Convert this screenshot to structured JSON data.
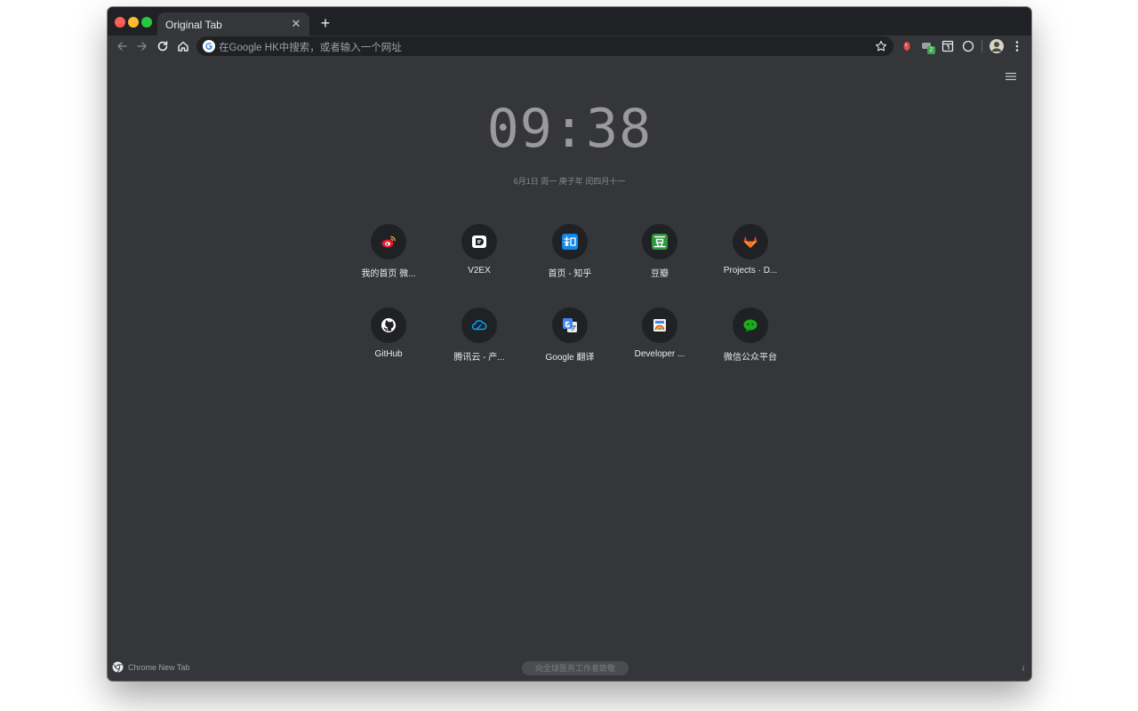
{
  "tab": {
    "title": "Original Tab",
    "close": "✕",
    "new": "+"
  },
  "omnibox": {
    "placeholder": "在Google HK中搜索，或者输入一个网址"
  },
  "extensions": {
    "badge": "2"
  },
  "clock": {
    "time": "09:38",
    "date": "6月1日 周一   庚子年 闰四月十一"
  },
  "shortcuts": [
    {
      "label": "我的首页 微...",
      "icon": "weibo-icon"
    },
    {
      "label": "V2EX",
      "icon": "v2ex-icon"
    },
    {
      "label": "首页 - 知乎",
      "icon": "zhihu-icon"
    },
    {
      "label": "豆瓣",
      "icon": "douban-icon"
    },
    {
      "label": "Projects · D...",
      "icon": "gitlab-icon"
    },
    {
      "label": "GitHub",
      "icon": "github-icon"
    },
    {
      "label": "腾讯云 - 产...",
      "icon": "tencent-cloud-icon"
    },
    {
      "label": "Google 翻译",
      "icon": "google-translate-icon"
    },
    {
      "label": "Developer ...",
      "icon": "developer-icon"
    },
    {
      "label": "微信公众平台",
      "icon": "wechat-icon"
    }
  ],
  "footer": {
    "brand": "Chrome New Tab",
    "message": "向全球医务工作者致敬",
    "info": "i"
  },
  "colors": {
    "window": "#35363a",
    "titlebar": "#202124",
    "text": "#e8eaed",
    "clock": "#9a9a9a"
  }
}
